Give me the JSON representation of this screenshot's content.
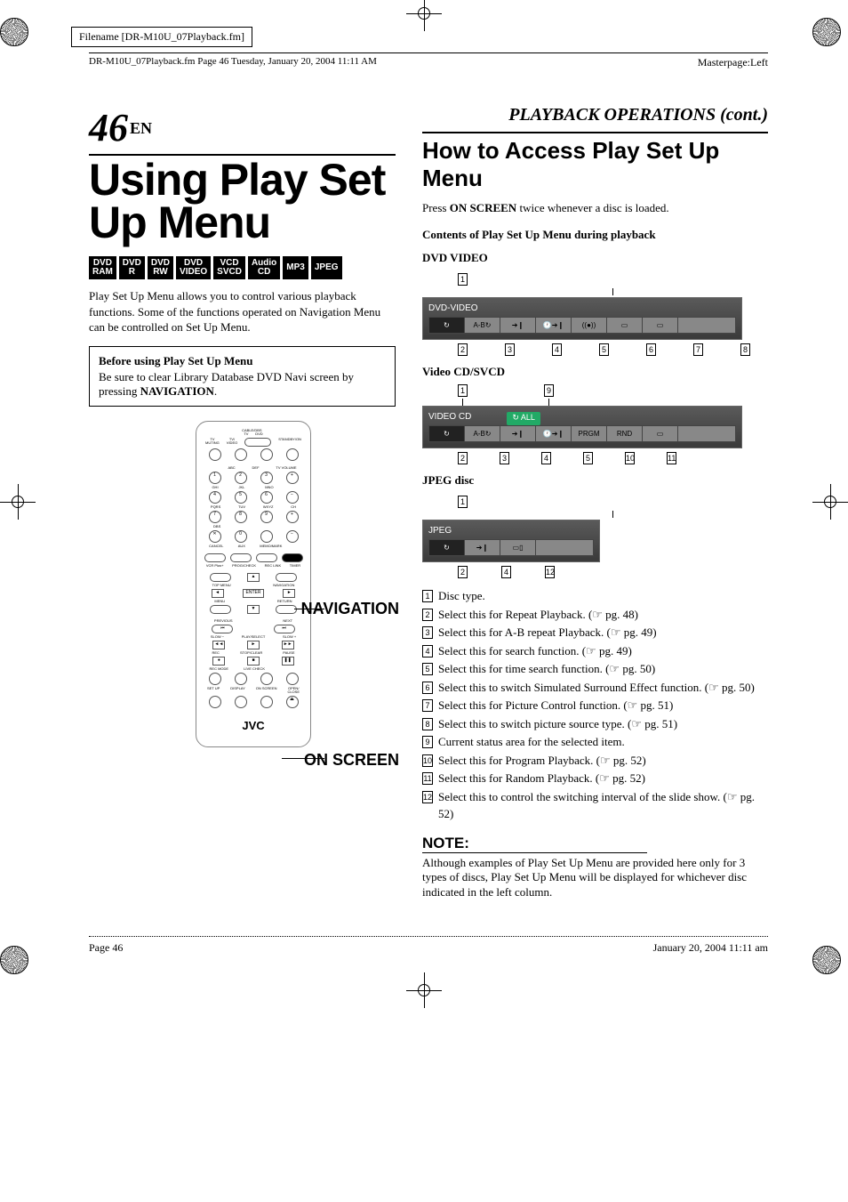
{
  "meta": {
    "filename_box": "Filename [DR-M10U_07Playback.fm]",
    "header_left": "DR-M10U_07Playback.fm  Page 46  Tuesday, January 20, 2004  11:11 AM",
    "masterpage": "Masterpage:Left",
    "page_num": "46",
    "en": "EN",
    "footer_page": "Page 46",
    "footer_date": "January 20, 2004 11:11 am"
  },
  "left": {
    "title": "Using Play Set Up Menu",
    "formats": [
      "DVD\nRAM",
      "DVD\nR",
      "DVD\nRW",
      "DVD\nVIDEO",
      "VCD\nSVCD",
      "Audio\nCD",
      "MP3",
      "JPEG"
    ],
    "intro": "Play Set Up Menu allows you to control various playback functions. Some of the functions operated on Navigation Menu can be controlled on Set Up Menu.",
    "before_title": "Before using Play Set Up Menu",
    "before_body_1": "Be sure to clear Library Database DVD Navi screen by pressing ",
    "before_body_nav": "NAVIGATION",
    "before_body_2": ".",
    "callout_nav": "NAVIGATION",
    "callout_osc": "ON SCREEN",
    "remote": {
      "top_labels": [
        "CABLE/DBS",
        "TV",
        "DVD",
        "TV MUTING",
        "TV/VIDEO",
        "STANDBY/ON",
        "VCR/DBS",
        "DVD"
      ],
      "keypad": [
        "1",
        "2",
        "3",
        "4",
        "5",
        "6",
        "7",
        "8",
        "9",
        "0"
      ],
      "kp_labels": [
        "ABC",
        "DEF",
        "TV VOLUME",
        "GHI",
        "JKL",
        "MNO",
        "PQRS",
        "TUV",
        "WXYZ",
        "CH",
        "DBS",
        "CANCEL",
        "AUX",
        "MEMO/MARK"
      ],
      "mid_labels": [
        "VCR Plus+",
        "PROG/CHECK",
        "REC LINK",
        "TIMER",
        "TOP MENU",
        "NAVIGATION",
        "ENTER",
        "MENU",
        "RETURN"
      ],
      "transport": [
        "PREVIOUS",
        "NEXT",
        "SLOW –",
        "PLAY/SELECT",
        "SLOW +",
        "REC",
        "STOP/CLEAR",
        "PAUSE",
        "REC MODE",
        "LIVE CHECK",
        "SET UP",
        "DISPLAY",
        "ON SCREEN",
        "OPEN/CLOSE"
      ],
      "brand": "JVC"
    }
  },
  "right": {
    "section": "PLAYBACK OPERATIONS (cont.)",
    "subtitle": "How to Access Play Set Up Menu",
    "press_1": "Press ",
    "press_bold": "ON SCREEN",
    "press_2": " twice whenever a disc is loaded.",
    "contents": "Contents of Play Set Up Menu during playback",
    "dvd_label": "DVD VIDEO",
    "vcd_label": "Video CD/SVCD",
    "jpeg_label": "JPEG disc",
    "osd_dvd_title": "DVD-VIDEO",
    "osd_vcd_title": "VIDEO CD",
    "osd_vcd_all": "ALL",
    "osd_jpeg_title": "JPEG",
    "osd_cells_vcd": [
      "",
      "A-B",
      "",
      "",
      "PRGM",
      "RND",
      ""
    ],
    "legend": [
      {
        "n": "1",
        "t": "Disc type."
      },
      {
        "n": "2",
        "t": "Select this for Repeat Playback. (☞ pg. 48)"
      },
      {
        "n": "3",
        "t": "Select this for A-B repeat Playback. (☞ pg. 49)"
      },
      {
        "n": "4",
        "t": "Select this for search function. (☞ pg. 49)"
      },
      {
        "n": "5",
        "t": "Select this for time search function. (☞ pg. 50)"
      },
      {
        "n": "6",
        "t": "Select this to switch Simulated Surround Effect function. (☞ pg. 50)"
      },
      {
        "n": "7",
        "t": "Select this for Picture Control function. (☞ pg. 51)"
      },
      {
        "n": "8",
        "t": "Select this to switch picture source type. (☞ pg. 51)"
      },
      {
        "n": "9",
        "t": "Current status area for the selected item."
      },
      {
        "n": "10",
        "t": "Select this for Program Playback. (☞ pg. 52)"
      },
      {
        "n": "11",
        "t": "Select this for Random Playback. (☞ pg. 52)"
      },
      {
        "n": "12",
        "t": "Select this to control the switching interval of the slide show. (☞ pg. 52)"
      }
    ],
    "note_hd": "NOTE:",
    "note_body": "Although examples of Play Set Up Menu are provided here only for 3 types of discs, Play Set Up Menu will be displayed for whichever disc indicated in the left column."
  },
  "callouts": {
    "dvd_top": [
      "1"
    ],
    "dvd_bottom": [
      "2",
      "3",
      "4",
      "5",
      "6",
      "7",
      "8"
    ],
    "vcd_top": [
      "1",
      "9"
    ],
    "vcd_bottom": [
      "2",
      "3",
      "4",
      "5",
      "10",
      "11"
    ],
    "jpeg_top": [
      "1"
    ],
    "jpeg_bottom": [
      "2",
      "4",
      "12"
    ]
  }
}
